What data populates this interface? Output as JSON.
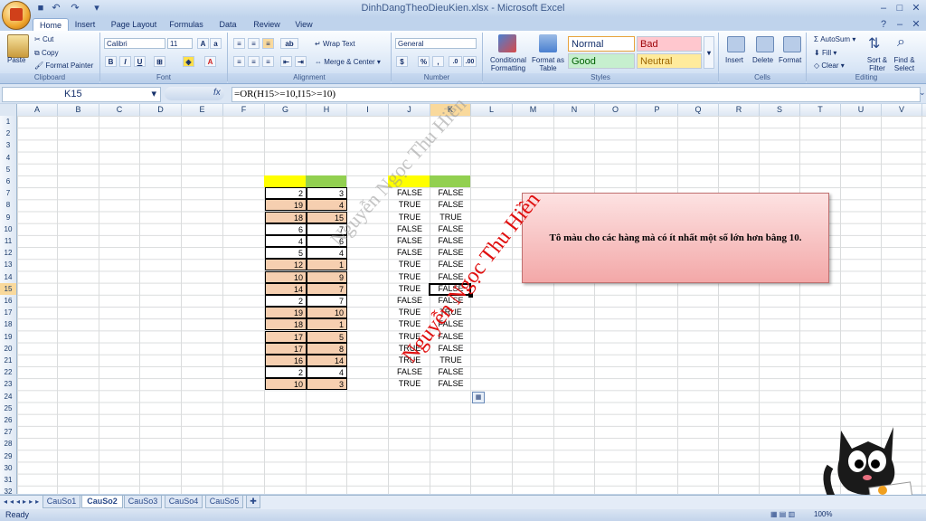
{
  "window": {
    "title": "DinhDangTheoDieuKien.xlsx - Microsoft Excel"
  },
  "tabs": [
    "Home",
    "Insert",
    "Page Layout",
    "Formulas",
    "Data",
    "Review",
    "View"
  ],
  "ribbon": {
    "clipboard": {
      "label": "Clipboard",
      "paste": "Paste",
      "cut": "Cut",
      "copy": "Copy",
      "format_painter": "Format Painter"
    },
    "font": {
      "label": "Font",
      "name": "Calibri",
      "size": "11"
    },
    "alignment": {
      "label": "Alignment",
      "wrap": "Wrap Text",
      "merge": "Merge & Center"
    },
    "number": {
      "label": "Number",
      "format": "General"
    },
    "styles": {
      "label": "Styles",
      "conditional": "Conditional Formatting",
      "format_table": "Format as Table",
      "normal": "Normal",
      "bad": "Bad",
      "good": "Good",
      "neutral": "Neutral"
    },
    "cells": {
      "label": "Cells",
      "insert": "Insert",
      "delete": "Delete",
      "format": "Format"
    },
    "editing": {
      "label": "Editing",
      "autosum": "AutoSum",
      "fill": "Fill",
      "clear": "Clear",
      "sort": "Sort & Filter",
      "find": "Find & Select"
    }
  },
  "formula_bar": {
    "name_box": "K15",
    "formula": "=OR(H15>=10,I15>=10)"
  },
  "columns": [
    "A",
    "B",
    "C",
    "D",
    "E",
    "F",
    "G",
    "H",
    "I",
    "J",
    "K",
    "L",
    "M",
    "N",
    "O",
    "P",
    "Q",
    "R",
    "S",
    "T",
    "U",
    "V"
  ],
  "rows": [
    "1",
    "2",
    "3",
    "4",
    "5",
    "6",
    "7",
    "8",
    "9",
    "10",
    "11",
    "12",
    "13",
    "14",
    "15",
    "16",
    "17",
    "18",
    "19",
    "20",
    "21",
    "22",
    "23",
    "24",
    "25",
    "26",
    "27",
    "28",
    "29",
    "30",
    "31",
    "32"
  ],
  "table": [
    {
      "g": "2",
      "h": "3",
      "j": "FALSE",
      "k": "FALSE",
      "hl": false
    },
    {
      "g": "19",
      "h": "4",
      "j": "TRUE",
      "k": "FALSE",
      "hl": true
    },
    {
      "g": "18",
      "h": "15",
      "j": "TRUE",
      "k": "TRUE",
      "hl": true
    },
    {
      "g": "6",
      "h": "7",
      "j": "FALSE",
      "k": "FALSE",
      "hl": false
    },
    {
      "g": "4",
      "h": "6",
      "j": "FALSE",
      "k": "FALSE",
      "hl": false
    },
    {
      "g": "5",
      "h": "4",
      "j": "FALSE",
      "k": "FALSE",
      "hl": false
    },
    {
      "g": "12",
      "h": "1",
      "j": "TRUE",
      "k": "FALSE",
      "hl": true
    },
    {
      "g": "10",
      "h": "9",
      "j": "TRUE",
      "k": "FALSE",
      "hl": true
    },
    {
      "g": "14",
      "h": "7",
      "j": "TRUE",
      "k": "FALSE",
      "hl": true
    },
    {
      "g": "2",
      "h": "7",
      "j": "FALSE",
      "k": "FALSE",
      "hl": false
    },
    {
      "g": "19",
      "h": "10",
      "j": "TRUE",
      "k": "TRUE",
      "hl": true
    },
    {
      "g": "18",
      "h": "1",
      "j": "TRUE",
      "k": "FALSE",
      "hl": true
    },
    {
      "g": "17",
      "h": "5",
      "j": "TRUE",
      "k": "FALSE",
      "hl": true
    },
    {
      "g": "17",
      "h": "8",
      "j": "TRUE",
      "k": "FALSE",
      "hl": true
    },
    {
      "g": "16",
      "h": "14",
      "j": "TRUE",
      "k": "TRUE",
      "hl": true
    },
    {
      "g": "2",
      "h": "4",
      "j": "FALSE",
      "k": "FALSE",
      "hl": false
    },
    {
      "g": "10",
      "h": "3",
      "j": "TRUE",
      "k": "FALSE",
      "hl": true
    }
  ],
  "note": {
    "text": "Tô màu cho các hàng mà có ít nhất một số lớn hơn bằng 10."
  },
  "watermark": "Nguyễn Ngọc Thu Hiền",
  "sheets": [
    "CauSo1",
    "CauSo2",
    "CauSo3",
    "CauSo4",
    "CauSo5"
  ],
  "status": {
    "ready": "Ready",
    "zoom": "100%"
  },
  "colors": {
    "yellow": "#ffff00",
    "green": "#92d050",
    "highlight": "#f6cfb0",
    "note_bg": "#f5b8b8"
  }
}
